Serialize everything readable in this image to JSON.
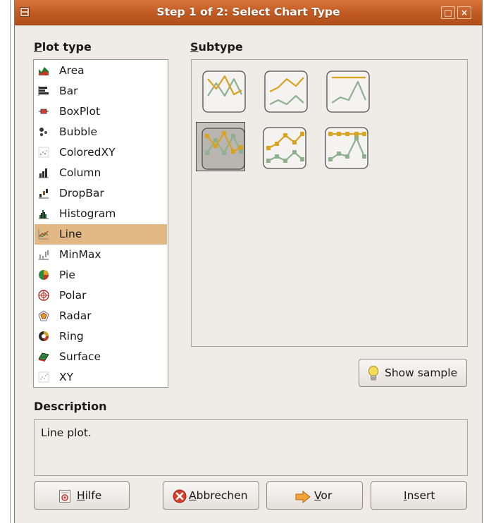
{
  "window": {
    "title": "Step 1 of 2: Select Chart Type"
  },
  "labels": {
    "plot_type": "Plot type",
    "subtype": "Subtype",
    "description": "Description"
  },
  "plot_types": [
    {
      "label": "Area",
      "icon": "area-chart-icon"
    },
    {
      "label": "Bar",
      "icon": "bar-chart-icon"
    },
    {
      "label": "BoxPlot",
      "icon": "boxplot-icon"
    },
    {
      "label": "Bubble",
      "icon": "bubble-chart-icon"
    },
    {
      "label": "ColoredXY",
      "icon": "colored-xy-icon"
    },
    {
      "label": "Column",
      "icon": "column-chart-icon"
    },
    {
      "label": "DropBar",
      "icon": "dropbar-icon"
    },
    {
      "label": "Histogram",
      "icon": "histogram-icon"
    },
    {
      "label": "Line",
      "icon": "line-chart-icon",
      "selected": true
    },
    {
      "label": "MinMax",
      "icon": "minmax-icon"
    },
    {
      "label": "Pie",
      "icon": "pie-chart-icon"
    },
    {
      "label": "Polar",
      "icon": "polar-chart-icon"
    },
    {
      "label": "Radar",
      "icon": "radar-chart-icon"
    },
    {
      "label": "Ring",
      "icon": "ring-chart-icon"
    },
    {
      "label": "Surface",
      "icon": "surface-chart-icon"
    },
    {
      "label": "XY",
      "icon": "xy-chart-icon"
    }
  ],
  "subtypes": [
    {
      "name": "line-normal",
      "markers": false
    },
    {
      "name": "line-stacked",
      "markers": false
    },
    {
      "name": "line-percent",
      "markers": false
    },
    {
      "name": "line-markers",
      "markers": true,
      "selected": true
    },
    {
      "name": "line-stacked-markers",
      "markers": true
    },
    {
      "name": "line-percent-markers",
      "markers": true
    }
  ],
  "description": "Line plot.",
  "buttons": {
    "show_sample": "Show sample",
    "help": "Hilfe",
    "cancel": "Abbrechen",
    "forward": "Vor",
    "insert": "Insert"
  },
  "colors": {
    "titlebar": "#c05a23",
    "selection": "#e1b884",
    "series_orange": "#d9a21f",
    "series_green": "#8fb08f",
    "window_bg": "#efebe7"
  }
}
